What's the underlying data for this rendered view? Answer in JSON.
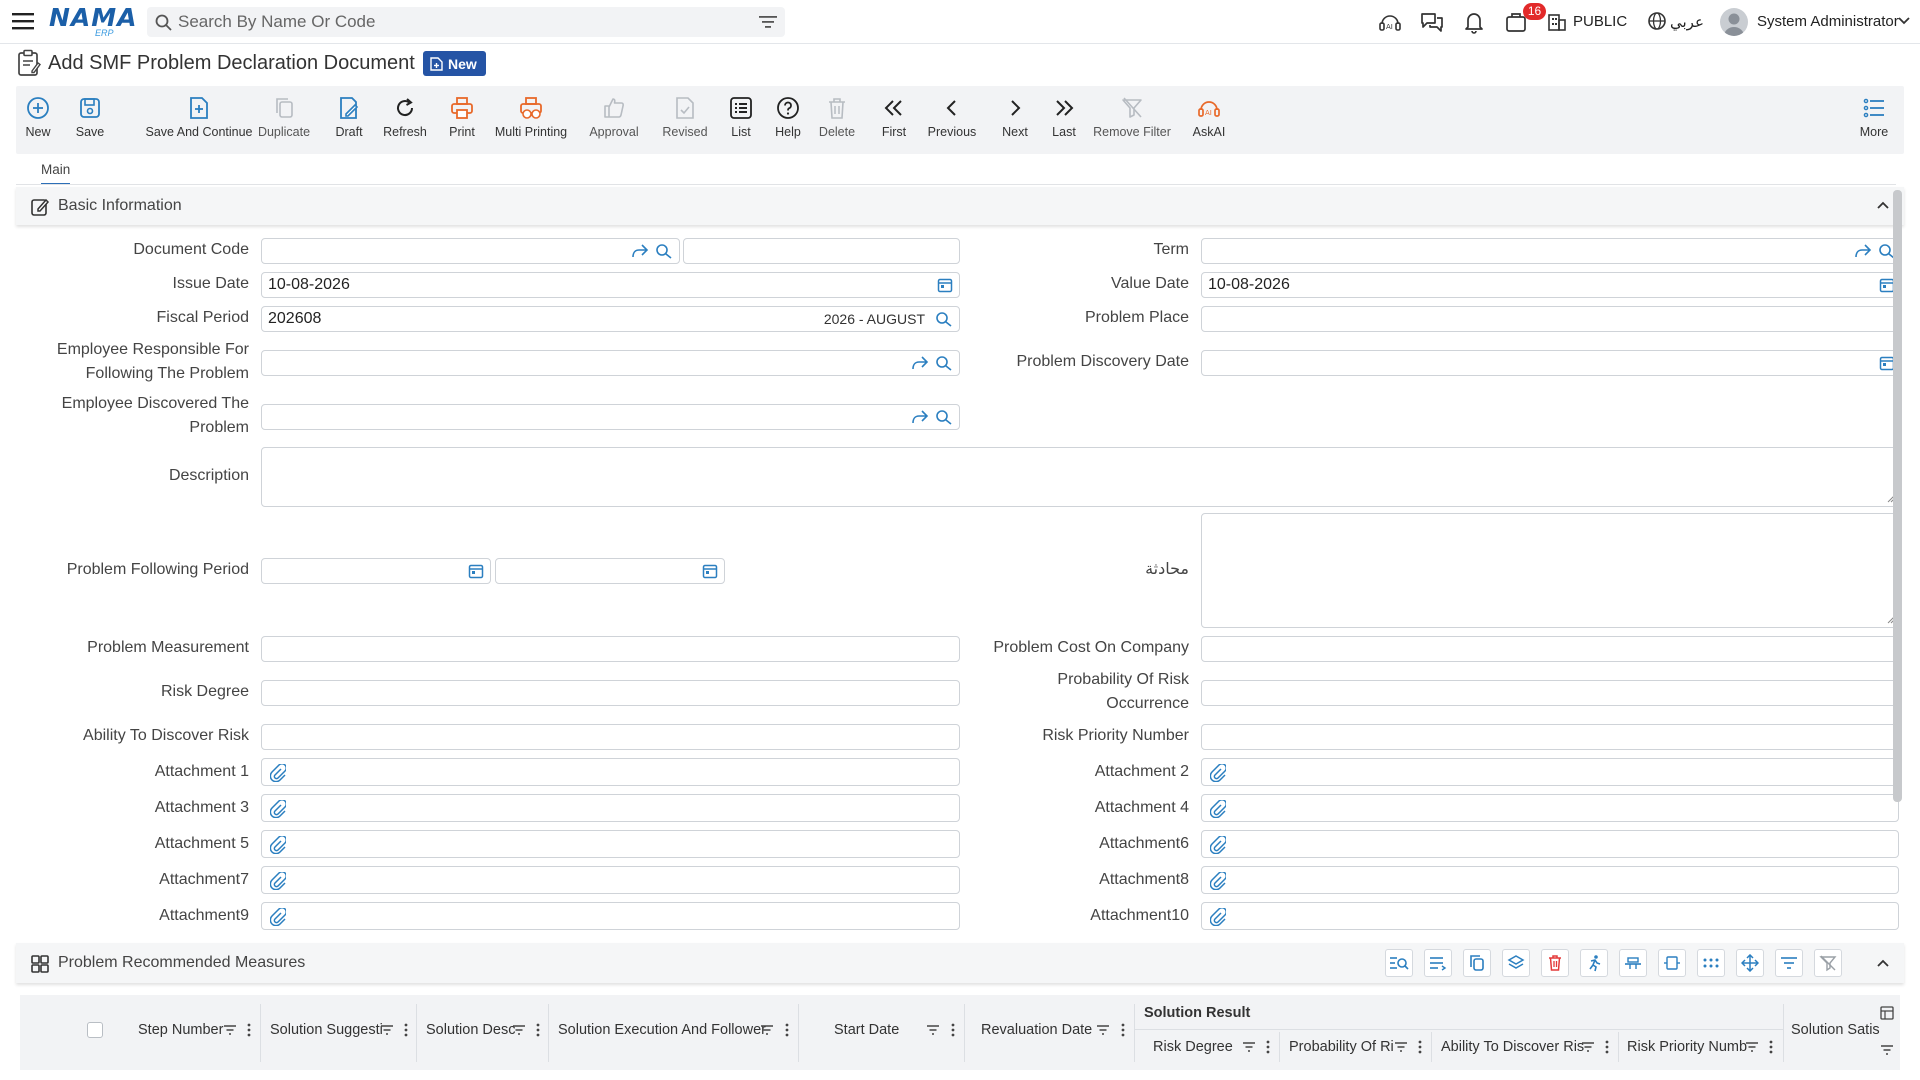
{
  "app": {
    "logo_main": "NAMA",
    "logo_sub": "ERP",
    "search_placeholder": "Search By Name Or Code",
    "notification_count": "16",
    "branch": "PUBLIC",
    "language": "عربي",
    "user": "System Administrator"
  },
  "page": {
    "title": "Add SMF Problem Declaration Document",
    "mode_badge": "New"
  },
  "toolbar": [
    {
      "label": "New",
      "icon": "plus-circle-icon"
    },
    {
      "label": "Save",
      "icon": "save-icon"
    },
    {
      "label": "Save And Continue",
      "icon": "save-continue-icon"
    },
    {
      "label": "Duplicate",
      "icon": "duplicate-icon"
    },
    {
      "label": "Draft",
      "icon": "draft-icon"
    },
    {
      "label": "Refresh",
      "icon": "refresh-icon"
    },
    {
      "label": "Print",
      "icon": "print-icon"
    },
    {
      "label": "Multi Printing",
      "icon": "multi-print-icon"
    },
    {
      "label": "Approval",
      "icon": "thumbs-up-icon"
    },
    {
      "label": "Revised",
      "icon": "revised-icon"
    },
    {
      "label": "List",
      "icon": "list-icon"
    },
    {
      "label": "Help",
      "icon": "help-icon"
    },
    {
      "label": "Delete",
      "icon": "trash-icon"
    },
    {
      "label": "First",
      "icon": "double-chevron-left-icon"
    },
    {
      "label": "Previous",
      "icon": "chevron-left-icon"
    },
    {
      "label": "Next",
      "icon": "chevron-right-icon"
    },
    {
      "label": "Last",
      "icon": "double-chevron-right-icon"
    },
    {
      "label": "Remove Filter",
      "icon": "remove-filter-icon"
    },
    {
      "label": "AskAI",
      "icon": "ai-icon"
    },
    {
      "label": "More",
      "icon": "more-list-icon"
    }
  ],
  "tabs": {
    "main": "Main"
  },
  "sections": {
    "basic": "Basic Information",
    "measures": "Problem Recommended Measures"
  },
  "form": {
    "document_code": {
      "label": "Document Code",
      "value": "",
      "value2": ""
    },
    "term": {
      "label": "Term",
      "value": ""
    },
    "issue_date": {
      "label": "Issue Date",
      "value": "10-08-2026"
    },
    "value_date": {
      "label": "Value Date",
      "value": "10-08-2026"
    },
    "fiscal_period": {
      "label": "Fiscal Period",
      "value": "202608",
      "desc": "2026 - AUGUST"
    },
    "problem_place": {
      "label": "Problem Place",
      "value": ""
    },
    "employee_responsible": {
      "label_1": "Employee Responsible For",
      "label_2": "Following The Problem",
      "value": ""
    },
    "problem_discovery_date": {
      "label": "Problem Discovery Date",
      "value": ""
    },
    "employee_discovered": {
      "label_1": "Employee Discovered The",
      "label_2": "Problem",
      "value": ""
    },
    "description": {
      "label": "Description",
      "value": ""
    },
    "problem_following_period": {
      "label": "Problem Following Period",
      "from": "",
      "to": ""
    },
    "conversation": {
      "label": "محادثة",
      "value": ""
    },
    "problem_measurement": {
      "label": "Problem Measurement",
      "value": ""
    },
    "problem_cost": {
      "label": "Problem Cost On Company",
      "value": ""
    },
    "risk_degree": {
      "label": "Risk Degree",
      "value": ""
    },
    "probability_risk": {
      "label_1": "Probability Of Risk",
      "label_2": "Occurrence",
      "value": ""
    },
    "ability_discover": {
      "label": "Ability To Discover Risk",
      "value": ""
    },
    "risk_priority": {
      "label": "Risk Priority Number",
      "value": ""
    },
    "attachments_left": [
      "Attachment 1",
      "Attachment 3",
      "Attachment 5",
      "Attachment7",
      "Attachment9"
    ],
    "attachments_right": [
      "Attachment 2",
      "Attachment 4",
      "Attachment6",
      "Attachment8",
      "Attachment10"
    ]
  },
  "grid": {
    "columns": {
      "step_number": "Step Number",
      "solution_suggestion": "Solution Suggesti",
      "solution_desc": "Solution Desc",
      "solution_execution": "Solution Execution And Follower",
      "start_date": "Start Date",
      "revaluation_date": "Revaluation Date",
      "solution_result": "Solution Result",
      "risk_degree": "Risk Degree",
      "probability": "Probability Of Ri",
      "ability": "Ability To Discover Ris",
      "risk_priority": "Risk Priority Numb",
      "solution_satis": "Solution Satis"
    }
  },
  "colors": {
    "accent": "#2554a5",
    "icon_blue": "#2b7fc0",
    "icon_orange": "#e8692a",
    "disabled": "#b7bcc2"
  }
}
